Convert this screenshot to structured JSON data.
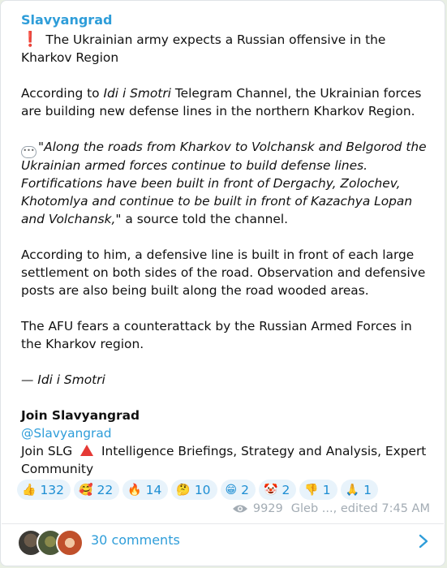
{
  "post": {
    "channel_name": "Slavyangrad",
    "headline": "The Ukrainian army expects a Russian offensive in the Kharkov Region",
    "p2_before": "According to ",
    "p2_source": "Idi i Smotri",
    "p2_after": " Telegram Channel, the Ukrainian forces are building new defense lines in the northern Kharkov Region.",
    "quote_italic": "\"Along the roads from Kharkov to Volchansk and Belgorod the Ukrainian armed forces continue to build defense lines. Fortifications have been built in front of Dergachy, Zolochev, Khotomlya and continue to be built in front of Kazachya Lopan and Volchansk,",
    "quote_after": "\" a source told the channel.",
    "p4": "According to him, a defensive line is built in front of each large settlement on both sides of the road. Observation and defensive posts are also being built along the road wooded areas.",
    "p5": "The AFU fears a counterattack by the Russian Armed Forces in the Kharkov region.",
    "attribution": "— Idi i Smotri",
    "join_title": "Join Slavyangrad",
    "join_handle": "@Slavyangrad",
    "join_before": "Join SLG ",
    "join_after": " Intelligence Briefings, Strategy and Analysis, Expert Community"
  },
  "reactions": [
    {
      "emoji": "👍",
      "count": "132"
    },
    {
      "emoji": "🥰",
      "count": "22"
    },
    {
      "emoji": "🔥",
      "count": "14"
    },
    {
      "emoji": "🤔",
      "count": "10"
    },
    {
      "emoji": "😁",
      "count": "2"
    },
    {
      "emoji": "🤡",
      "count": "2"
    },
    {
      "emoji": "👎",
      "count": "1"
    },
    {
      "emoji": "🙏",
      "count": "1"
    }
  ],
  "meta": {
    "views": "9929",
    "author": "Gleb ...",
    "edited": "edited 7:45 AM"
  },
  "comments": {
    "label": "30 comments"
  },
  "colors": {
    "accent": "#2e9dd9",
    "chip_bg": "#e8f3fb",
    "alert_red": "#e53935"
  }
}
